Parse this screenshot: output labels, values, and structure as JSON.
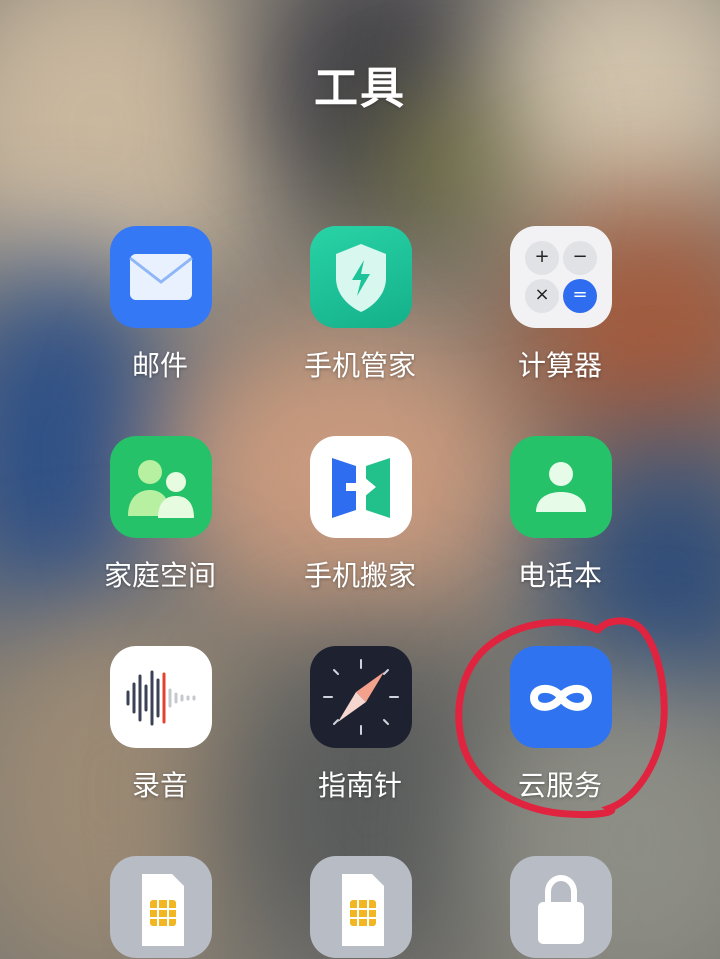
{
  "folder": {
    "title": "工具"
  },
  "apps": [
    {
      "label": "邮件",
      "icon": "mail-icon",
      "color": "#3478f6"
    },
    {
      "label": "手机管家",
      "icon": "shield-bolt-icon",
      "color": "#1fc39a"
    },
    {
      "label": "计算器",
      "icon": "calculator-icon",
      "color": "#f2f2f4"
    },
    {
      "label": "家庭空间",
      "icon": "family-icon",
      "color": "#25c26a"
    },
    {
      "label": "手机搬家",
      "icon": "phone-clone-icon",
      "color": "#ffffff"
    },
    {
      "label": "电话本",
      "icon": "contact-icon",
      "color": "#25c26a"
    },
    {
      "label": "录音",
      "icon": "waveform-icon",
      "color": "#ffffff"
    },
    {
      "label": "指南针",
      "icon": "compass-icon",
      "color": "#1e2230"
    },
    {
      "label": "云服务",
      "icon": "cloud-infinity-icon",
      "color": "#2f73f0"
    },
    {
      "label": "",
      "icon": "sim-card-icon",
      "color": "#b8bcc4"
    },
    {
      "label": "",
      "icon": "sim-card-icon",
      "color": "#b8bcc4"
    },
    {
      "label": "",
      "icon": "lock-icon",
      "color": "#b8bcc4"
    }
  ],
  "calculator_keys": [
    "+",
    "−",
    "×",
    "="
  ],
  "annotation": {
    "color": "#e0243f"
  }
}
